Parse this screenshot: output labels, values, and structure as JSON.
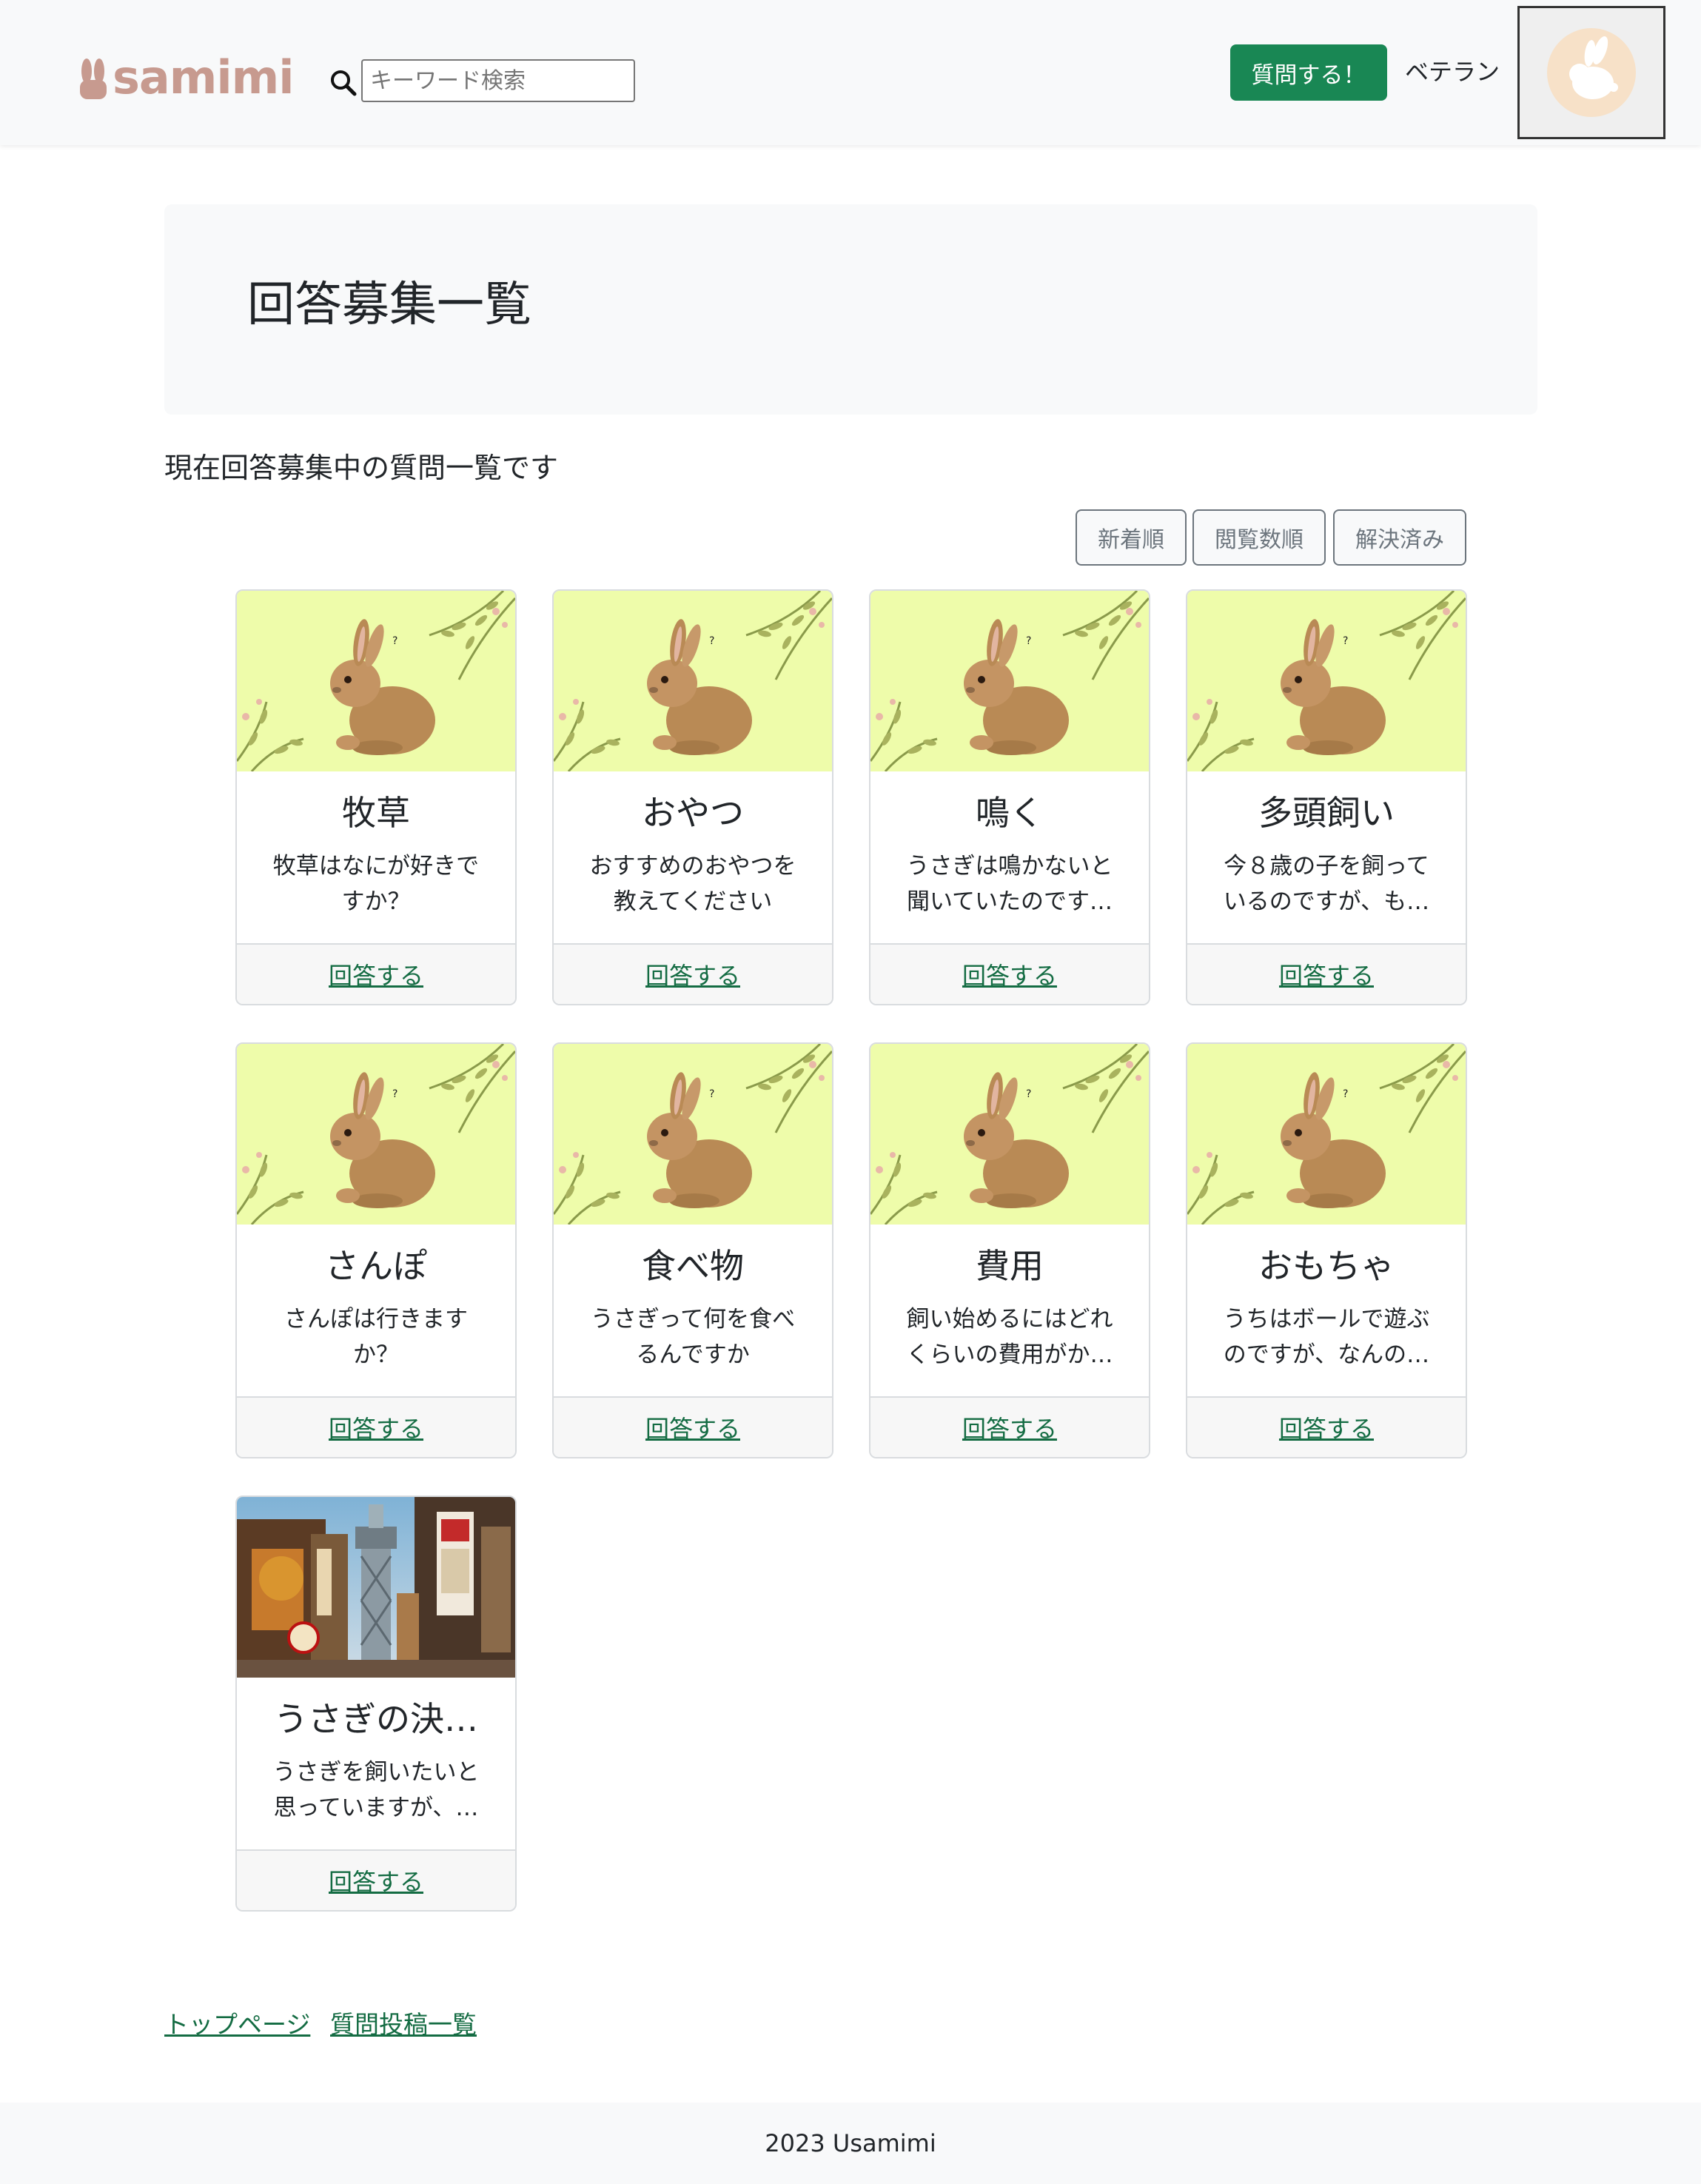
{
  "header": {
    "logo_text": "samimi",
    "search": {
      "placeholder": "キーワード検索",
      "value": ""
    },
    "ask_button": "質問する！",
    "user_rank": "ベテラン"
  },
  "page": {
    "title": "回答募集一覧",
    "lead": "現在回答募集中の質問一覧です"
  },
  "sort_buttons": [
    "新着順",
    "閲覧数順",
    "解決済み"
  ],
  "cards": [
    {
      "title": "牧草",
      "text": "牧草はなにが好きですか？",
      "link": "回答する",
      "image": "rabbit-image"
    },
    {
      "title": "おやつ",
      "text": "おすすめのおやつを教えてください",
      "link": "回答する",
      "image": "rabbit-image"
    },
    {
      "title": "鳴く",
      "text": "うさぎは鳴かないと聞いていたのです…",
      "link": "回答する",
      "image": "rabbit-image"
    },
    {
      "title": "多頭飼い",
      "text": "今８歳の子を飼っているのですが、も…",
      "link": "回答する",
      "image": "rabbit-image"
    },
    {
      "title": "さんぽ",
      "text": "さんぽは行きますか？",
      "link": "回答する",
      "image": "rabbit-image"
    },
    {
      "title": "食べ物",
      "text": "うさぎって何を食べるんですか",
      "link": "回答する",
      "image": "rabbit-image"
    },
    {
      "title": "費用",
      "text": "飼い始めるにはどれくらいの費用がか…",
      "link": "回答する",
      "image": "rabbit-image"
    },
    {
      "title": "おもちゃ",
      "text": "うちはボールで遊ぶのですが、なんの…",
      "link": "回答する",
      "image": "rabbit-image"
    },
    {
      "title": "うさぎの決…",
      "text": "うさぎを飼いたいと思っていますが、…",
      "link": "回答する",
      "image": "city-street-image"
    }
  ],
  "bottom_links": [
    "トップページ",
    "質問投稿一覧"
  ],
  "footer": {
    "copyright": "2023 Usamimi"
  },
  "colors": {
    "primary_green": "#198754",
    "link_green": "#146c43",
    "logo_pink": "#c79a8f",
    "card_bg_yellow": "#eefcaa",
    "light_bg": "#f8f9fa"
  }
}
